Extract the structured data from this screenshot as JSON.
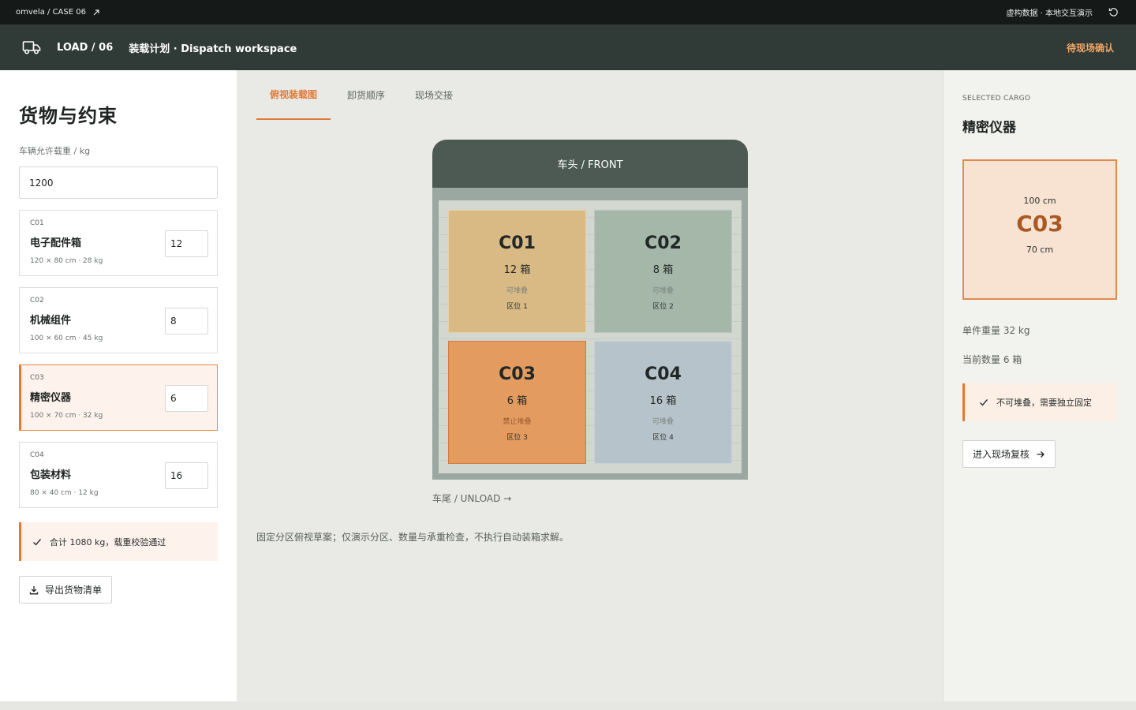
{
  "topbar": {
    "breadcrumb": "omvela / CASE 06",
    "info": "虚构数据 · 本地交互演示"
  },
  "header": {
    "load_code": "LOAD / 06",
    "title": "装载计划 · Dispatch workspace",
    "status": "待现场确认"
  },
  "sidebar": {
    "title": "货物与约束",
    "weight_label": "车辆允许载重 / kg",
    "weight_value": "1200",
    "cargo": [
      {
        "code": "C01",
        "name": "电子配件箱",
        "dims": "120 × 80 cm · 28 kg",
        "qty": "12"
      },
      {
        "code": "C02",
        "name": "机械组件",
        "dims": "100 × 60 cm · 45 kg",
        "qty": "8"
      },
      {
        "code": "C03",
        "name": "精密仪器",
        "dims": "100 × 70 cm · 32 kg",
        "qty": "6"
      },
      {
        "code": "C04",
        "name": "包装材料",
        "dims": "80 × 40 cm · 12 kg",
        "qty": "16"
      }
    ],
    "summary": "合计 1080 kg，载重校验通过",
    "export_label": "导出货物清单"
  },
  "tabs": [
    {
      "label": "俯视装载图"
    },
    {
      "label": "卸货顺序"
    },
    {
      "label": "现场交接"
    }
  ],
  "truck": {
    "front_label": "车头 / FRONT",
    "rear_label": "车尾 / UNLOAD →",
    "slots": [
      {
        "code": "C01",
        "qty": "12 箱",
        "stack": "可堆叠",
        "zone": "区位 1"
      },
      {
        "code": "C02",
        "qty": "8 箱",
        "stack": "可堆叠",
        "zone": "区位 2"
      },
      {
        "code": "C03",
        "qty": "6 箱",
        "stack": "禁止堆叠",
        "zone": "区位 3"
      },
      {
        "code": "C04",
        "qty": "16 箱",
        "stack": "可堆叠",
        "zone": "区位 4"
      }
    ]
  },
  "note": "固定分区俯视草案；仅演示分区、数量与承重检查，不执行自动装箱求解。",
  "selected": {
    "kicker": "SELECTED CARGO",
    "name": "精密仪器",
    "width": "100 cm",
    "code": "C03",
    "height": "70 cm",
    "unit_weight": "单件重量 32 kg",
    "count": "当前数量 6 箱",
    "warning": "不可堆叠，需要独立固定",
    "review_label": "进入现场复核"
  },
  "colors": {
    "accent": "#e07a36",
    "header_bg": "#303a37",
    "status": "#f2a765"
  }
}
